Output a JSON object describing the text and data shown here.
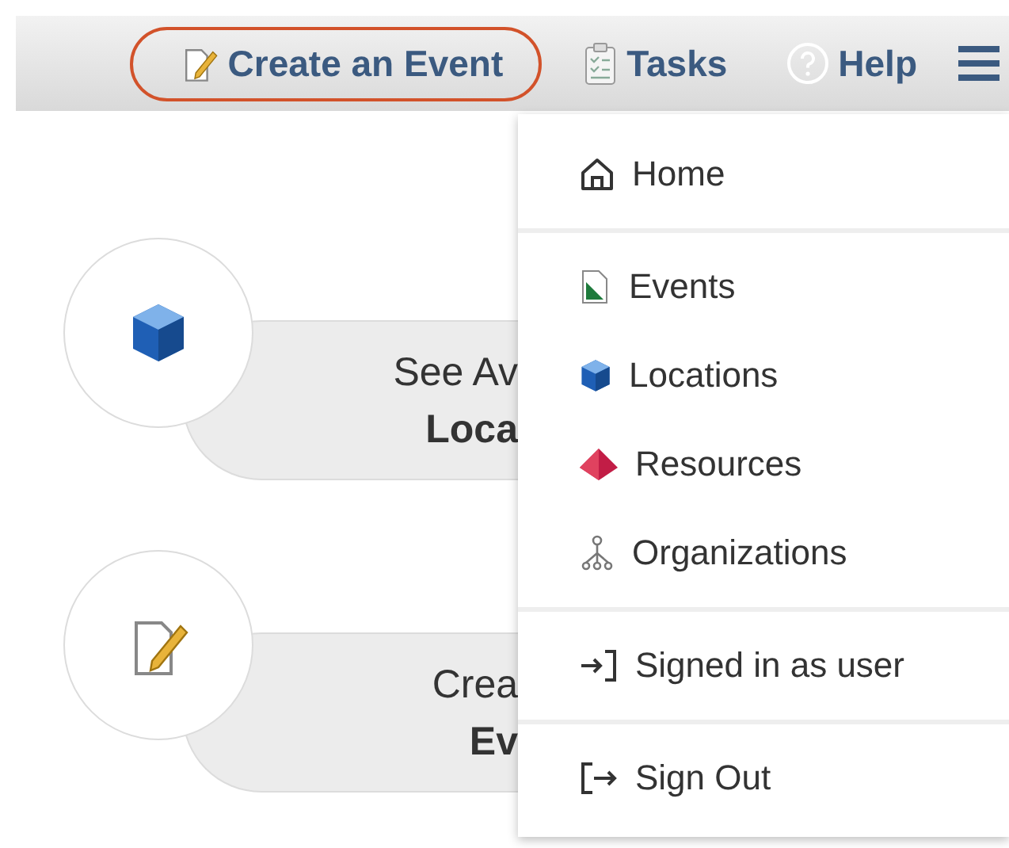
{
  "nav": [
    {
      "label": "Create an Event",
      "highlighted": true
    },
    {
      "label": "Tasks",
      "highlighted": false
    },
    {
      "label": "Help",
      "highlighted": false
    }
  ],
  "cards": [
    {
      "line1": "See Av",
      "line2": "Loca"
    },
    {
      "line1": "Crea",
      "line2": "Ev"
    }
  ],
  "menu": {
    "sections": [
      [
        {
          "label": "Home"
        }
      ],
      [
        {
          "label": "Events"
        },
        {
          "label": "Locations"
        },
        {
          "label": "Resources"
        },
        {
          "label": "Organizations"
        }
      ],
      [
        {
          "label": "Signed in as user"
        }
      ],
      [
        {
          "label": "Sign Out"
        }
      ]
    ]
  }
}
